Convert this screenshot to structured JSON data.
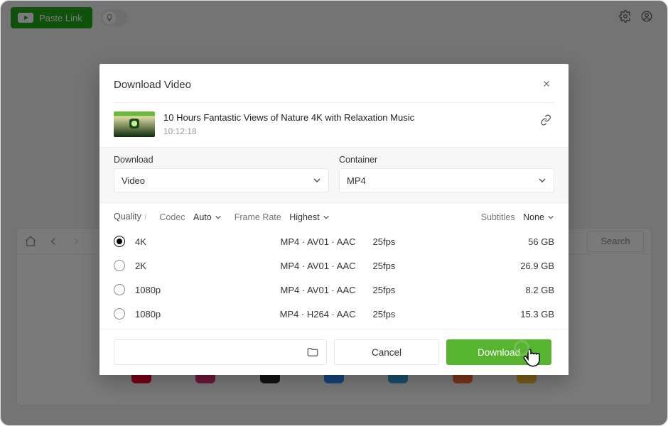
{
  "topbar": {
    "paste_label": "Paste Link",
    "search_placeholder": "Search"
  },
  "modal": {
    "title": "Download Video",
    "video_title": "10 Hours Fantastic Views of Nature 4K with Relaxation Music",
    "duration": "10:12:18",
    "download_label": "Download",
    "download_value": "Video",
    "container_label": "Container",
    "container_value": "MP4",
    "quality_label": "Quality",
    "codec_label": "Codec",
    "codec_value": "Auto",
    "framerate_label": "Frame Rate",
    "framerate_value": "Highest",
    "subtitles_label": "Subtitles",
    "subtitles_value": "None",
    "rows": [
      {
        "quality": "4K",
        "codec": "MP4 · AV01 · AAC",
        "fps": "25fps",
        "size": "56 GB",
        "selected": true
      },
      {
        "quality": "2K",
        "codec": "MP4 · AV01 · AAC",
        "fps": "25fps",
        "size": "26.9 GB",
        "selected": false
      },
      {
        "quality": "1080p",
        "codec": "MP4 · AV01 · AAC",
        "fps": "25fps",
        "size": "8.2 GB",
        "selected": false
      },
      {
        "quality": "1080p",
        "codec": "MP4 · H264 · AAC",
        "fps": "25fps",
        "size": "15.3 GB",
        "selected": false
      }
    ],
    "cancel_label": "Cancel",
    "download_btn_label": "Download"
  },
  "brands": [
    {
      "name": "youtube",
      "color": "#ff0033"
    },
    {
      "name": "instagram",
      "color": "#e73076"
    },
    {
      "name": "unknown1",
      "color": "#2a2a2a"
    },
    {
      "name": "unknown2",
      "color": "#2f8cff"
    },
    {
      "name": "bilibili",
      "color": "#35a7e2"
    },
    {
      "name": "sites",
      "color": "#ff6f3c"
    },
    {
      "name": "unknown3",
      "color": "#ffc233"
    }
  ],
  "colors": {
    "accent_green": "#23aa1d",
    "download_green": "#57b430"
  }
}
